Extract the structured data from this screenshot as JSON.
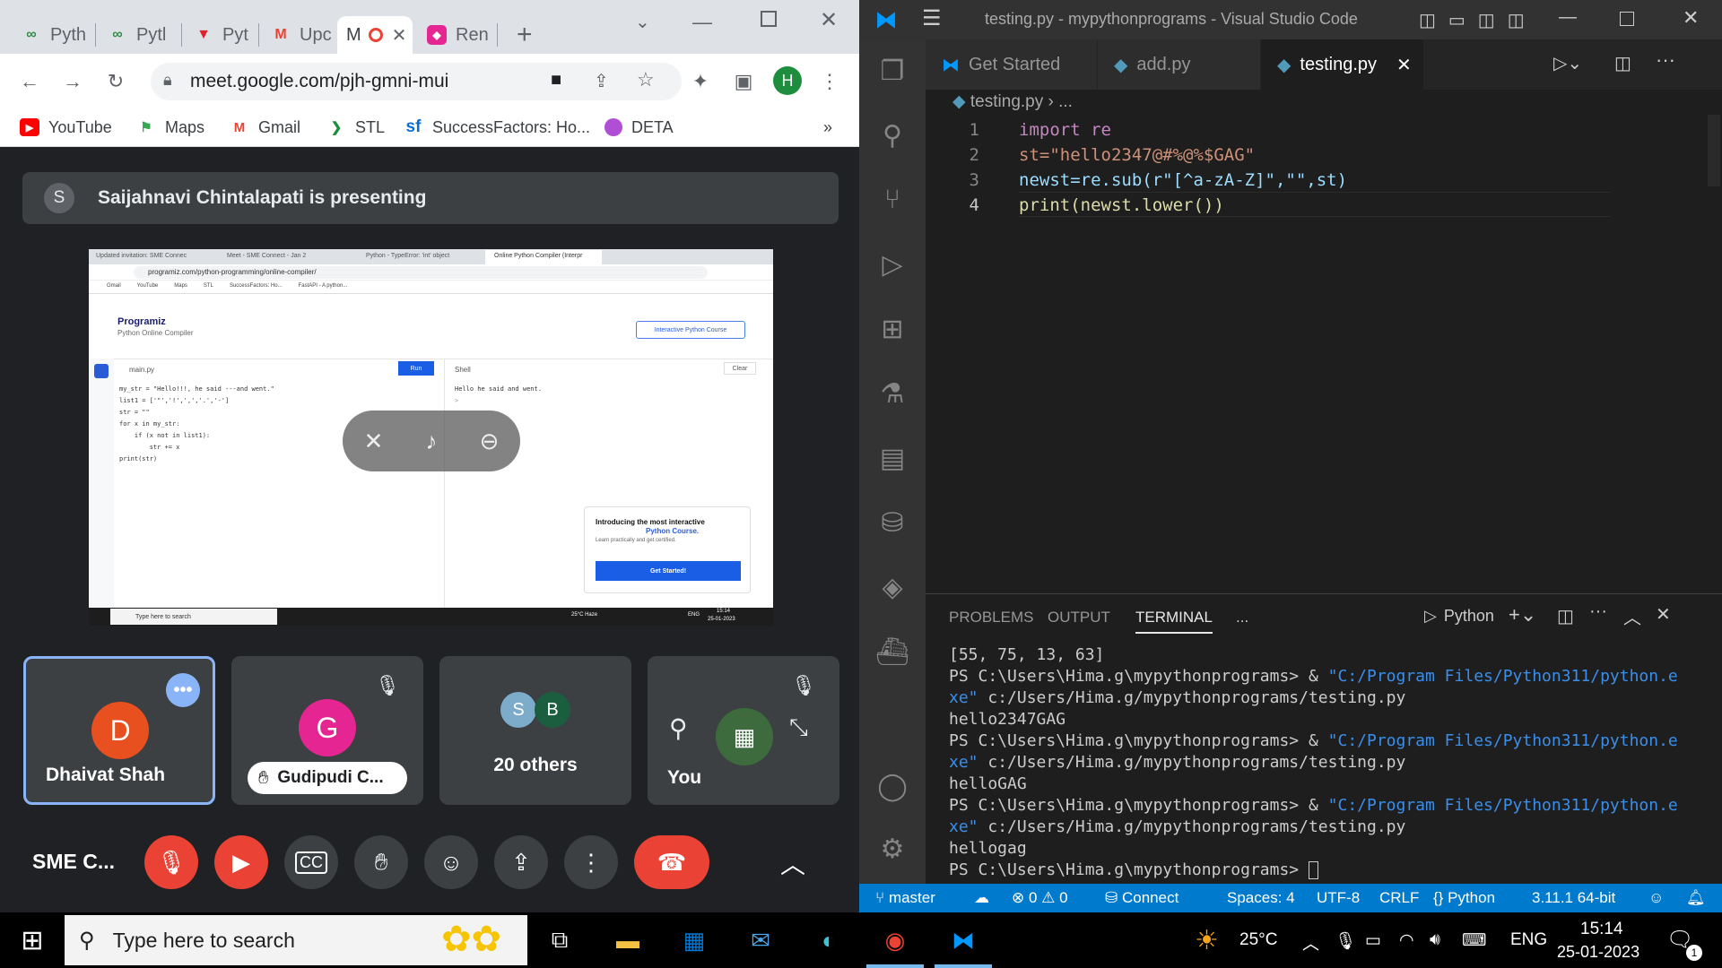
{
  "chrome": {
    "tabs": [
      {
        "label": "Pyth",
        "icon": "gfg-icon"
      },
      {
        "label": "Pytl",
        "icon": "gfg-icon"
      },
      {
        "label": "Pyt",
        "icon": "vivaldi-icon"
      },
      {
        "label": "Upc",
        "icon": "gmail-icon"
      },
      {
        "label": "M",
        "icon": "recording-icon",
        "active": true
      },
      {
        "label": "Ren",
        "icon": "app-icon"
      }
    ],
    "url": "meet.google.com/pjh-gmni-mui",
    "profile_initial": "H",
    "bookmarks": [
      "YouTube",
      "Maps",
      "Gmail",
      "STL",
      "SuccessFactors: Ho...",
      "DETA"
    ],
    "bookmarks_overflow": "»"
  },
  "meet": {
    "presenter_initial": "S",
    "presenting_text": "Saijahnavi Chintalapati is presenting",
    "shared_screen": {
      "tabs": [
        "Updated invitation: SME Connec",
        "Meet - SME Connect - Jan 2",
        "Python - TypeError: 'int' object",
        "Online Python Compiler (Interpr"
      ],
      "url": "programiz.com/python-programming/online-compiler/",
      "bookmarks": [
        "Gmail",
        "YouTube",
        "Maps",
        "STL",
        "SuccessFactors: Ho...",
        "FastAPI - A python..."
      ],
      "brand": "Programiz",
      "subtitle": "Python Online Compiler",
      "course_button": "Interactive Python Course",
      "file": "main.py",
      "run": "Run",
      "shell": "Shell",
      "clear": "Clear",
      "code": [
        "my_str = \"Hello!!!, he said ---and went.\"",
        "list1 = ['\"','!',',','.','-']",
        "str = \"\"",
        "for x in my_str:",
        "    if (x not in list1):",
        "        str += x",
        "print(str)"
      ],
      "output": "Hello he said and went.",
      "output_prompt": ">",
      "promo_title": "Introducing the most interactive",
      "promo_highlight": "Python Course.",
      "promo_sub": "Learn practically and get certified.",
      "promo_button": "Get Started!",
      "taskbar_search": "Type here to search",
      "weather": "25°C  Haze",
      "lang": "ENG",
      "time": "15:14",
      "date": "25-01-2023"
    },
    "participants": [
      {
        "name": "Dhaivat Shah",
        "initial": "D",
        "color": "#e8501f"
      },
      {
        "name": "Gudipudi C...",
        "initial": "G",
        "color": "#e52592"
      },
      {
        "name": "20 others",
        "initials": [
          "S",
          "B"
        ]
      },
      {
        "name": "You"
      }
    ],
    "meeting_title": "SME C..."
  },
  "vscode": {
    "title": "testing.py - mypythonprograms - Visual Studio Code",
    "tabs": [
      "Get Started",
      "add.py",
      "testing.py"
    ],
    "breadcrumb": "testing.py",
    "breadcrumb_more": "...",
    "lines": [
      {
        "n": "1",
        "text": "import re"
      },
      {
        "n": "2",
        "text": "st=\"hello2347@#%@%$GAG\""
      },
      {
        "n": "3",
        "text": "newst=re.sub(r\"[^a-zA-Z]\",\"\",st)"
      },
      {
        "n": "4",
        "text": "print(newst.lower())"
      }
    ],
    "panel_tabs": [
      "PROBLEMS",
      "OUTPUT",
      "TERMINAL",
      "..."
    ],
    "terminal_kind": "Python",
    "terminal": [
      "[55, 75, 13, 63]",
      "PS C:\\Users\\Hima.g\\mypythonprograms> & ",
      "\"C:/Program Files/Python311/python.e",
      "xe\"",
      " c:/Users/Hima.g/mypythonprograms/testing.py",
      "hello2347GAG",
      "helloGAG",
      "hellogag",
      "PS C:\\Users\\Hima.g\\mypythonprograms> "
    ],
    "status": {
      "branch": "master",
      "errors": "0",
      "warnings": "0",
      "connect": "Connect",
      "spaces": "Spaces: 4",
      "encoding": "UTF-8",
      "eol": "CRLF",
      "language": "Python",
      "interpreter": "3.11.1 64-bit"
    }
  },
  "taskbar": {
    "search_placeholder": "Type here to search",
    "temperature": "25°C",
    "language": "ENG",
    "time": "15:14",
    "date": "25-01-2023",
    "notifications": "1"
  },
  "colors": {
    "vscode_blue": "#007acc",
    "meet_red": "#ea4335",
    "tile_highlight": "#8ab4f8"
  }
}
